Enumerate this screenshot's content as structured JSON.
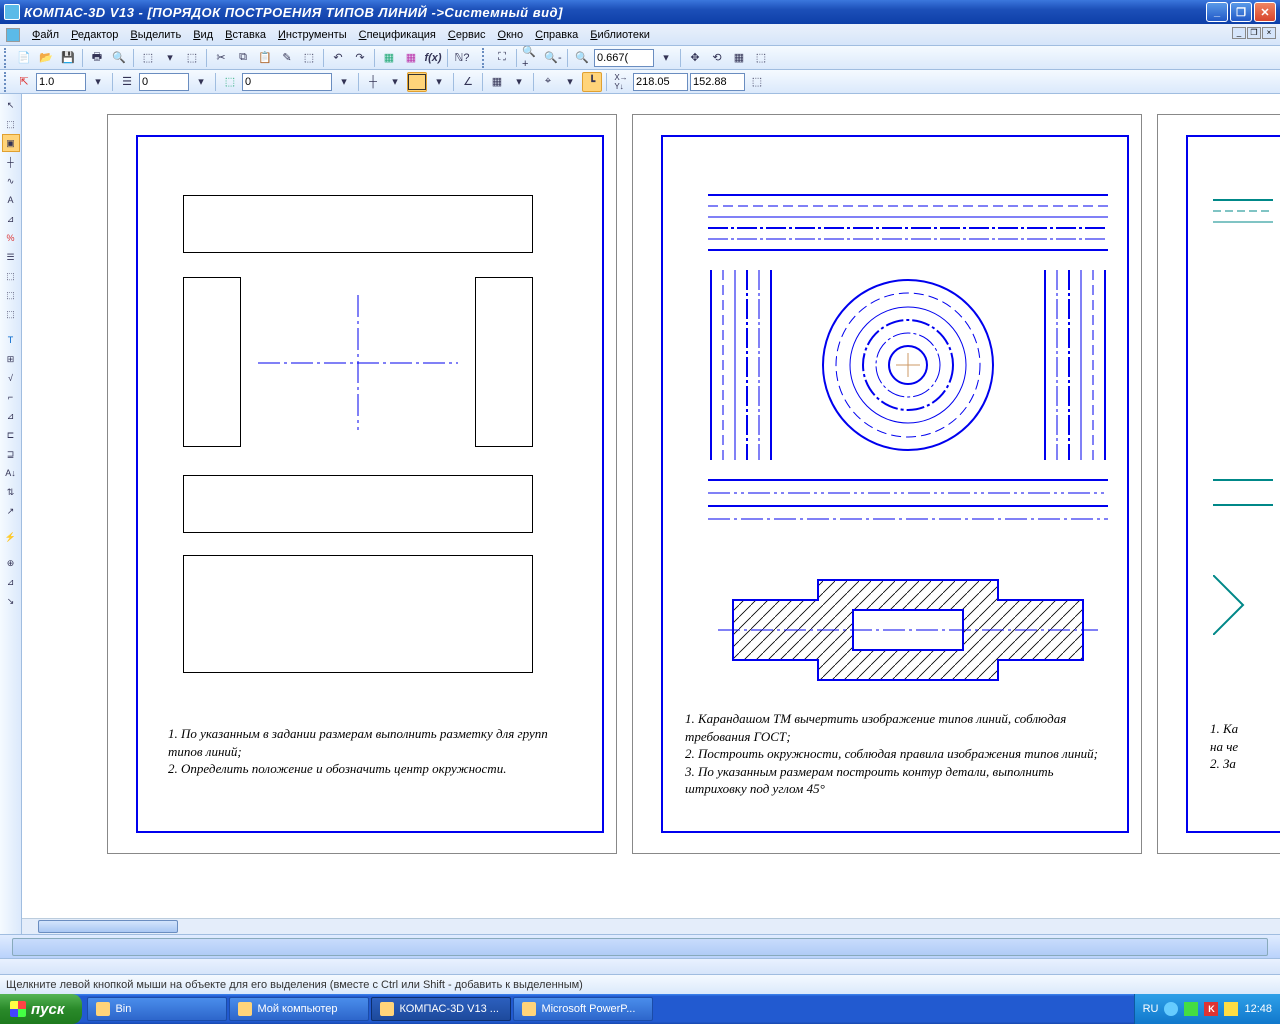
{
  "title": "КОМПАС-3D V13 - [ПОРЯДОК ПОСТРОЕНИЯ ТИПОВ ЛИНИЙ ->Системный вид]",
  "menus": [
    "Файл",
    "Редактор",
    "Выделить",
    "Вид",
    "Вставка",
    "Инструменты",
    "Спецификация",
    "Сервис",
    "Окно",
    "Справка",
    "Библиотеки"
  ],
  "tb2": {
    "zoom": "0.667("
  },
  "tb3": {
    "scale": "1.0",
    "layer": "0",
    "style_num": "0",
    "coord_x": "218.05",
    "coord_y": "152.88"
  },
  "sheet1": {
    "text": "1. По указанным в задании размерам выполнить разметку для групп типов линий;\n2. Определить положение и обозначить центр окружности."
  },
  "sheet2": {
    "text": "1. Карандашом ТМ вычертить изображение типов линий, соблюдая требования ГОСТ;\n2. Построить окружности, соблюдая правила изображения типов линий;\n3. По указанным размерам построить контур детали, выполнить штриховку под углом 45°"
  },
  "sheet3": {
    "text": "1. Ка\nна чe\n2. За"
  },
  "status": "Щелкните левой кнопкой мыши на объекте для его выделения (вместе с Ctrl или Shift - добавить к выделенным)",
  "taskbar": {
    "start": "пуск",
    "tasks": [
      "Bin",
      "Мой компьютер",
      "КОМПАС-3D V13 ...",
      "Microsoft PowerP..."
    ],
    "lang": "RU",
    "time": "12:48"
  }
}
